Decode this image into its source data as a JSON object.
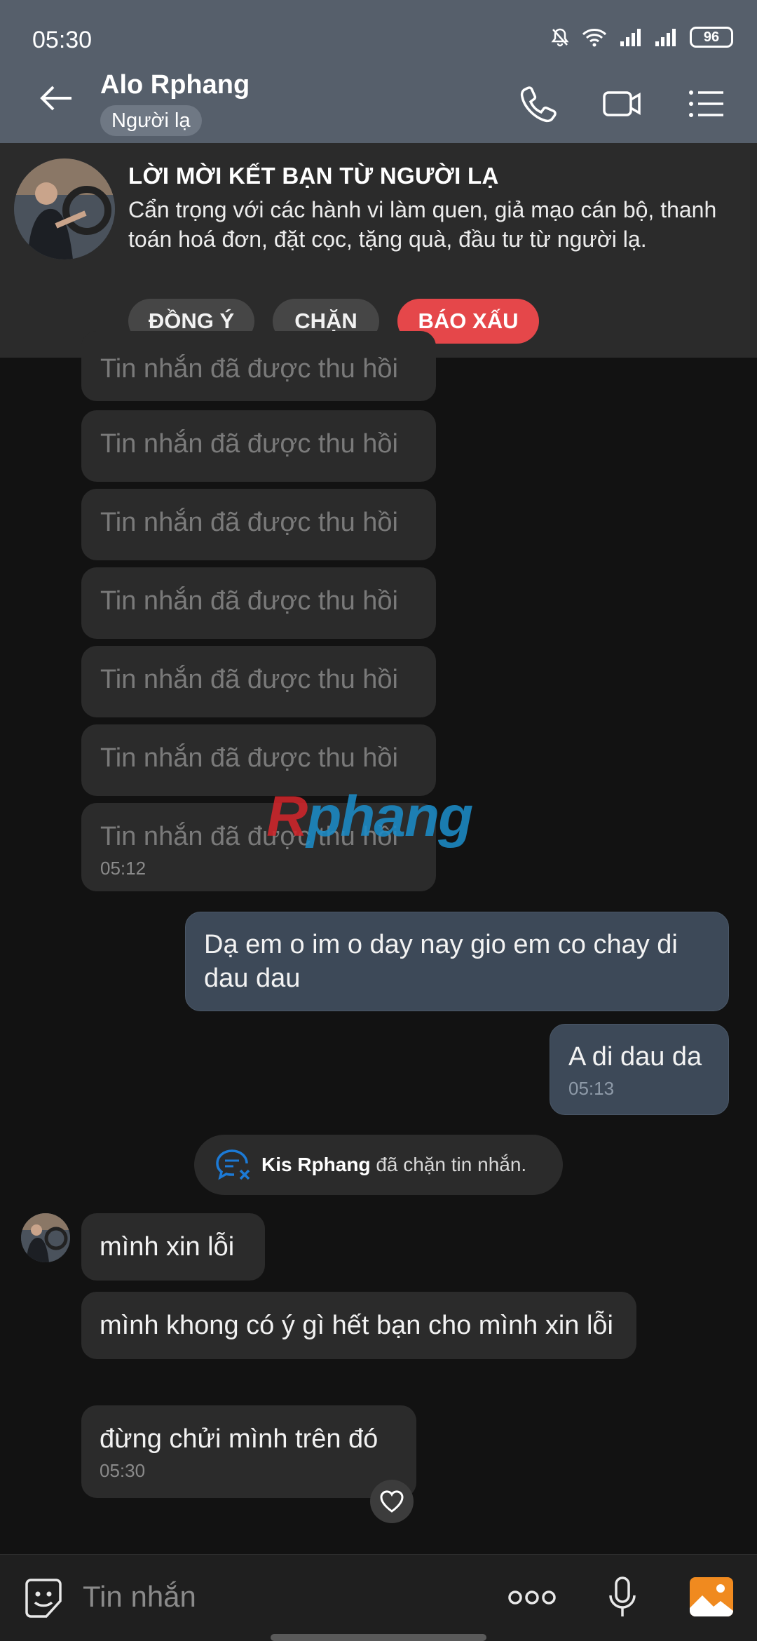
{
  "status_bar": {
    "time": "05:30",
    "battery": "96",
    "icons": [
      "mute-bell-icon",
      "wifi-icon",
      "signal-icon",
      "signal-icon",
      "battery-icon"
    ]
  },
  "header": {
    "name": "Alo Rphang",
    "badge": "Người lạ",
    "icons": [
      "back-arrow-icon",
      "phone-icon",
      "video-call-icon",
      "menu-list-icon"
    ]
  },
  "friend_request": {
    "title": "LỜI MỜI KẾT BẠN TỪ NGƯỜI LẠ",
    "warning": "Cẩn trọng với các hành vi làm quen, giả mạo cán bộ, thanh toán hoá đơn, đặt cọc, tặng quà, đầu tư từ người lạ.",
    "accept_label": "ĐỒNG Ý",
    "block_label": "CHẶN",
    "report_label": "BÁO XẤU",
    "report_color": "#e5474a"
  },
  "messages": {
    "recalled_text": "Tin nhắn đã được thu hồi",
    "recalled_time": "05:12",
    "sent_1": "Dạ em o im o day nay gio em co chay di dau dau",
    "sent_2": "A di dau da",
    "sent_2_time": "05:13",
    "system_name": "Kis Rphang",
    "system_text": "đã chặn tin nhắn.",
    "recv_1": "mình xin lỗi",
    "recv_2": "mình khong có ý gì hết bạn cho mình xin lỗi",
    "recv_3": "đừng chửi mình trên đó",
    "recv_3_time": "05:30"
  },
  "watermark": {
    "first": "R",
    "rest": "phang"
  },
  "input_bar": {
    "placeholder": "Tin nhắn",
    "icons": [
      "sticker-icon",
      "more-icon",
      "microphone-icon",
      "image-icon"
    ]
  },
  "colors": {
    "header_bg": "#565f6b",
    "sent_bubble": "#3d4958",
    "received_bubble": "#2b2b2b",
    "background": "#121212"
  }
}
